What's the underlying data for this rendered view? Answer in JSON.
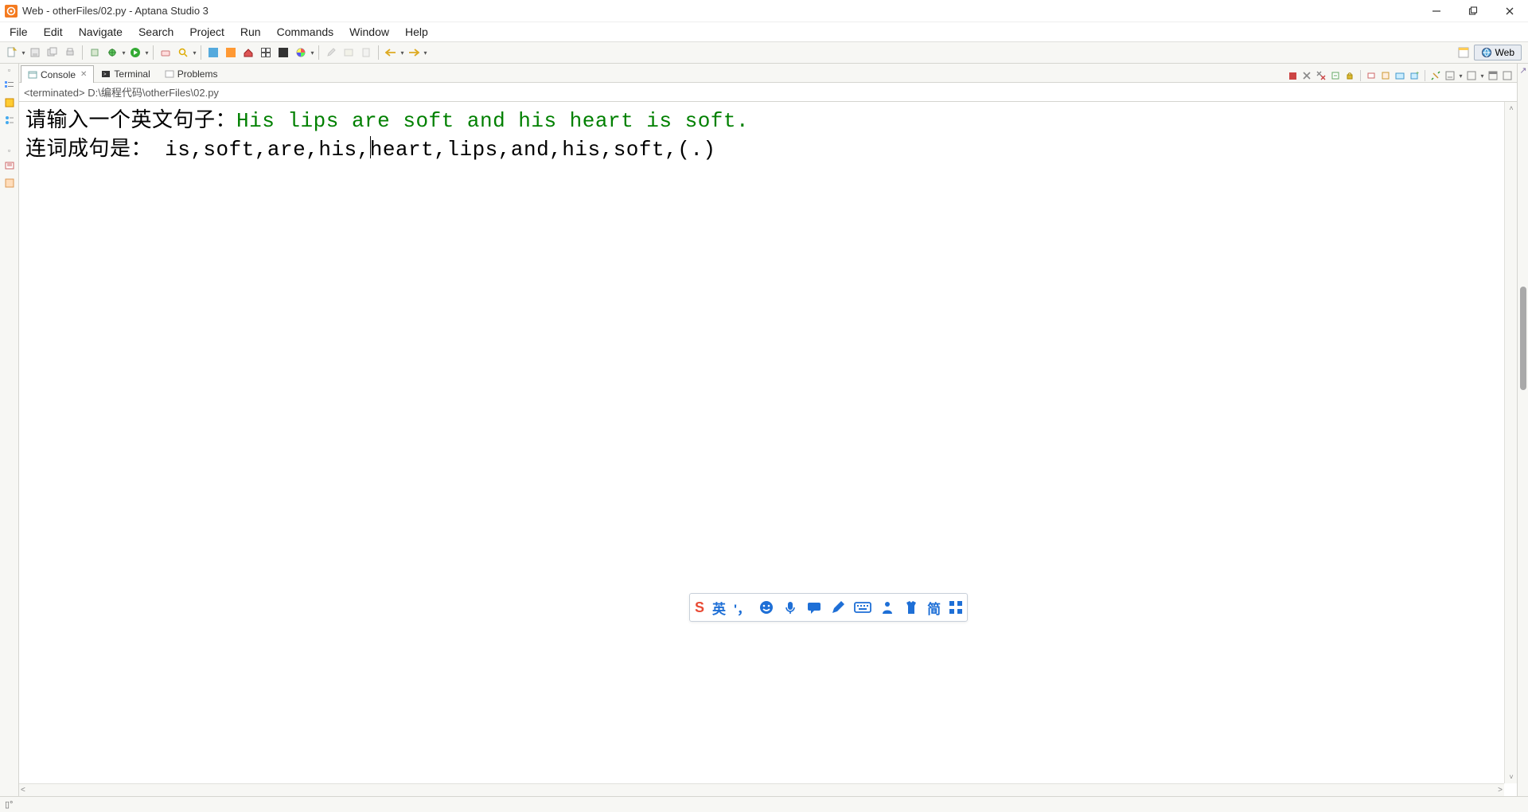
{
  "window": {
    "title": "Web - otherFiles/02.py - Aptana Studio 3"
  },
  "menu": {
    "items": [
      "File",
      "Edit",
      "Navigate",
      "Search",
      "Project",
      "Run",
      "Commands",
      "Window",
      "Help"
    ]
  },
  "perspective": {
    "label": "Web"
  },
  "tabs": {
    "console": "Console",
    "terminal": "Terminal",
    "problems": "Problems"
  },
  "console": {
    "terminated": "<terminated> D:\\编程代码\\otherFiles\\02.py",
    "line1_prompt": "请输入一个英文句子：",
    "line1_input": "His lips are soft and his heart is soft.",
    "line2_label": "连词成句是： ",
    "line2_value_before_cursor": "is,soft,are,his,",
    "line2_value_after_cursor": "heart,lips,and,his,soft,(.)"
  },
  "ime": {
    "logo": "S",
    "lang": "英",
    "punct": "'，",
    "simp": "简"
  },
  "status": {
    "left": "▯°"
  }
}
